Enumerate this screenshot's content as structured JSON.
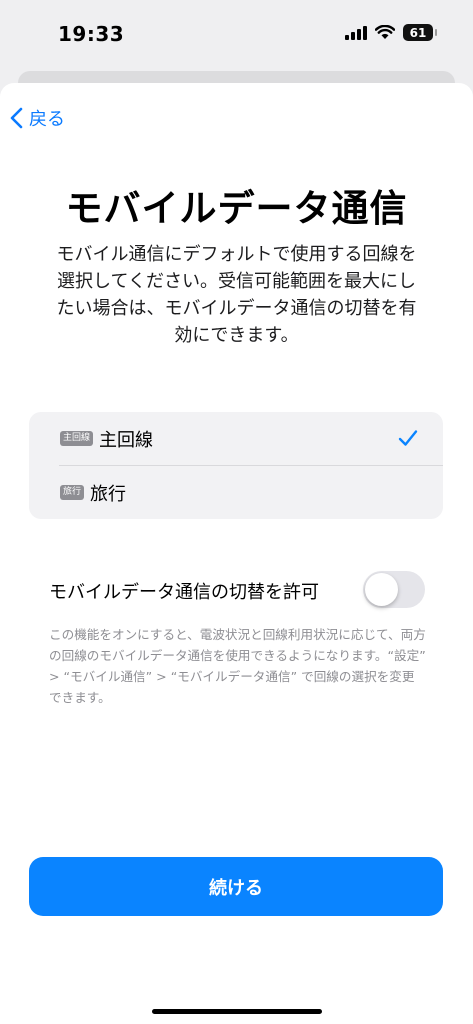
{
  "status_bar": {
    "time": "19:33",
    "battery": "61"
  },
  "nav": {
    "back_label": "戻る"
  },
  "page": {
    "title": "モバイルデータ通信",
    "description": "モバイル通信にデフォルトで使用する回線を選択してください。受信可能範囲を最大にしたい場合は、モバイルデータ通信の切替を有効にできます。"
  },
  "lines": [
    {
      "badge": "主回線",
      "label": "主回線",
      "selected": true
    },
    {
      "badge": "旅行",
      "label": "旅行",
      "selected": false
    }
  ],
  "toggle": {
    "label": "モバイルデータ通信の切替を許可",
    "enabled": false
  },
  "footnote": "この機能をオンにすると、電波状況と回線利用状況に応じて、両方の回線のモバイルデータ通信を使用できるようになります。“設定” > “モバイル通信” > “モバイルデータ通信” で回線の選択を変更できます。",
  "actions": {
    "continue_label": "続ける"
  },
  "colors": {
    "accent": "#0a84ff",
    "link": "#0a7aff"
  }
}
